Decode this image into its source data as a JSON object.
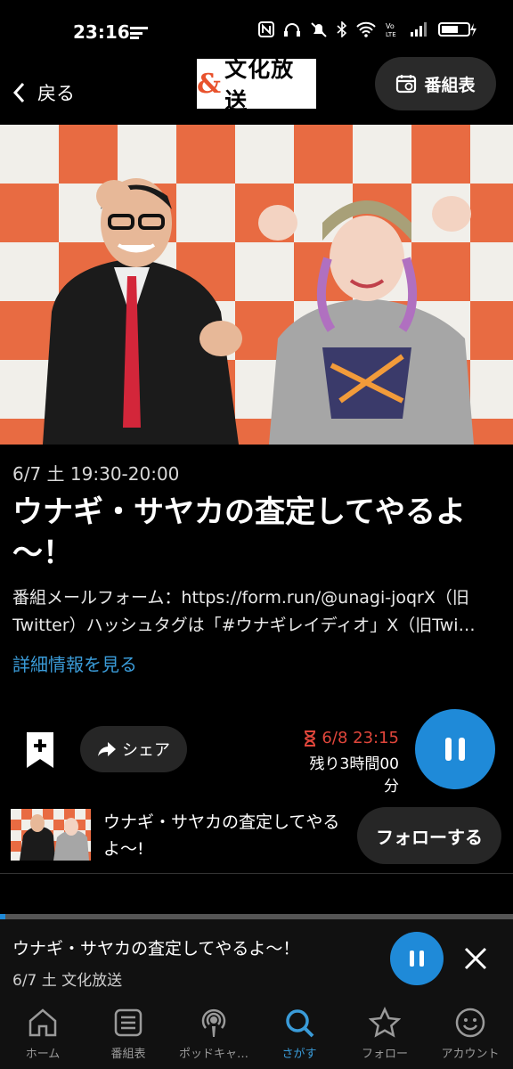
{
  "status_bar": {
    "time": "23:16"
  },
  "header": {
    "back_label": "戻る",
    "logo_amp": "&",
    "logo_text": "文化放送",
    "schedule_label": "番組表"
  },
  "episode": {
    "date": "6/7 土 19:30-20:00",
    "title": "ウナギ・サヤカの査定してやるよ～！",
    "description": "番組メールフォーム：https://form.run/@unagi-joqrX（旧Twitter）ハッシュタグは「#ウナギレイディオ」X（旧Twi…",
    "more_label": "詳細情報を見る"
  },
  "actions": {
    "share_label": "シェア",
    "deadline": "6/8 23:15",
    "remaining": "残り3時間00分"
  },
  "program": {
    "title": "ウナギ・サヤカの査定してやるよ～!",
    "follow_label": "フォローする"
  },
  "player": {
    "progress": 0.01,
    "title": "ウナギ・サヤカの査定してやるよ～！",
    "subtitle": "6/7 土 文化放送"
  },
  "nav": {
    "items": [
      {
        "label": "ホーム",
        "icon": "home-icon"
      },
      {
        "label": "番組表",
        "icon": "schedule-icon"
      },
      {
        "label": "ポッドキャ…",
        "icon": "podcast-icon"
      },
      {
        "label": "さがす",
        "icon": "search-icon"
      },
      {
        "label": "フォロー",
        "icon": "star-icon"
      },
      {
        "label": "アカウント",
        "icon": "account-icon"
      }
    ],
    "active_index": 3
  },
  "colors": {
    "accent": "#1f8ad8",
    "deadline": "#e0463b",
    "logo": "#e8522d"
  }
}
